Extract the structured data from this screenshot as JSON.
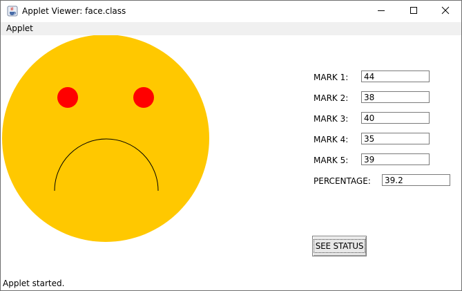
{
  "window": {
    "title": "Applet Viewer: face.class",
    "icon": "java-cup-icon",
    "controls": [
      "minimize-icon",
      "maximize-icon",
      "close-icon"
    ]
  },
  "menu": {
    "items": [
      "Applet"
    ]
  },
  "face": {
    "expression": "sad",
    "face_color": "#FFC800",
    "eye_color": "#FF0000",
    "mouth_color": "#000000"
  },
  "form": {
    "marks": [
      {
        "label": "MARK 1:",
        "value": "44"
      },
      {
        "label": "MARK 2:",
        "value": "38"
      },
      {
        "label": "MARK 3:",
        "value": "40"
      },
      {
        "label": "MARK 4:",
        "value": "35"
      },
      {
        "label": "MARK 5:",
        "value": "39"
      }
    ],
    "percentage_label": "PERCENTAGE:",
    "percentage_value": "39.2",
    "status_button": "SEE STATUS"
  },
  "status": {
    "text": "Applet started."
  }
}
